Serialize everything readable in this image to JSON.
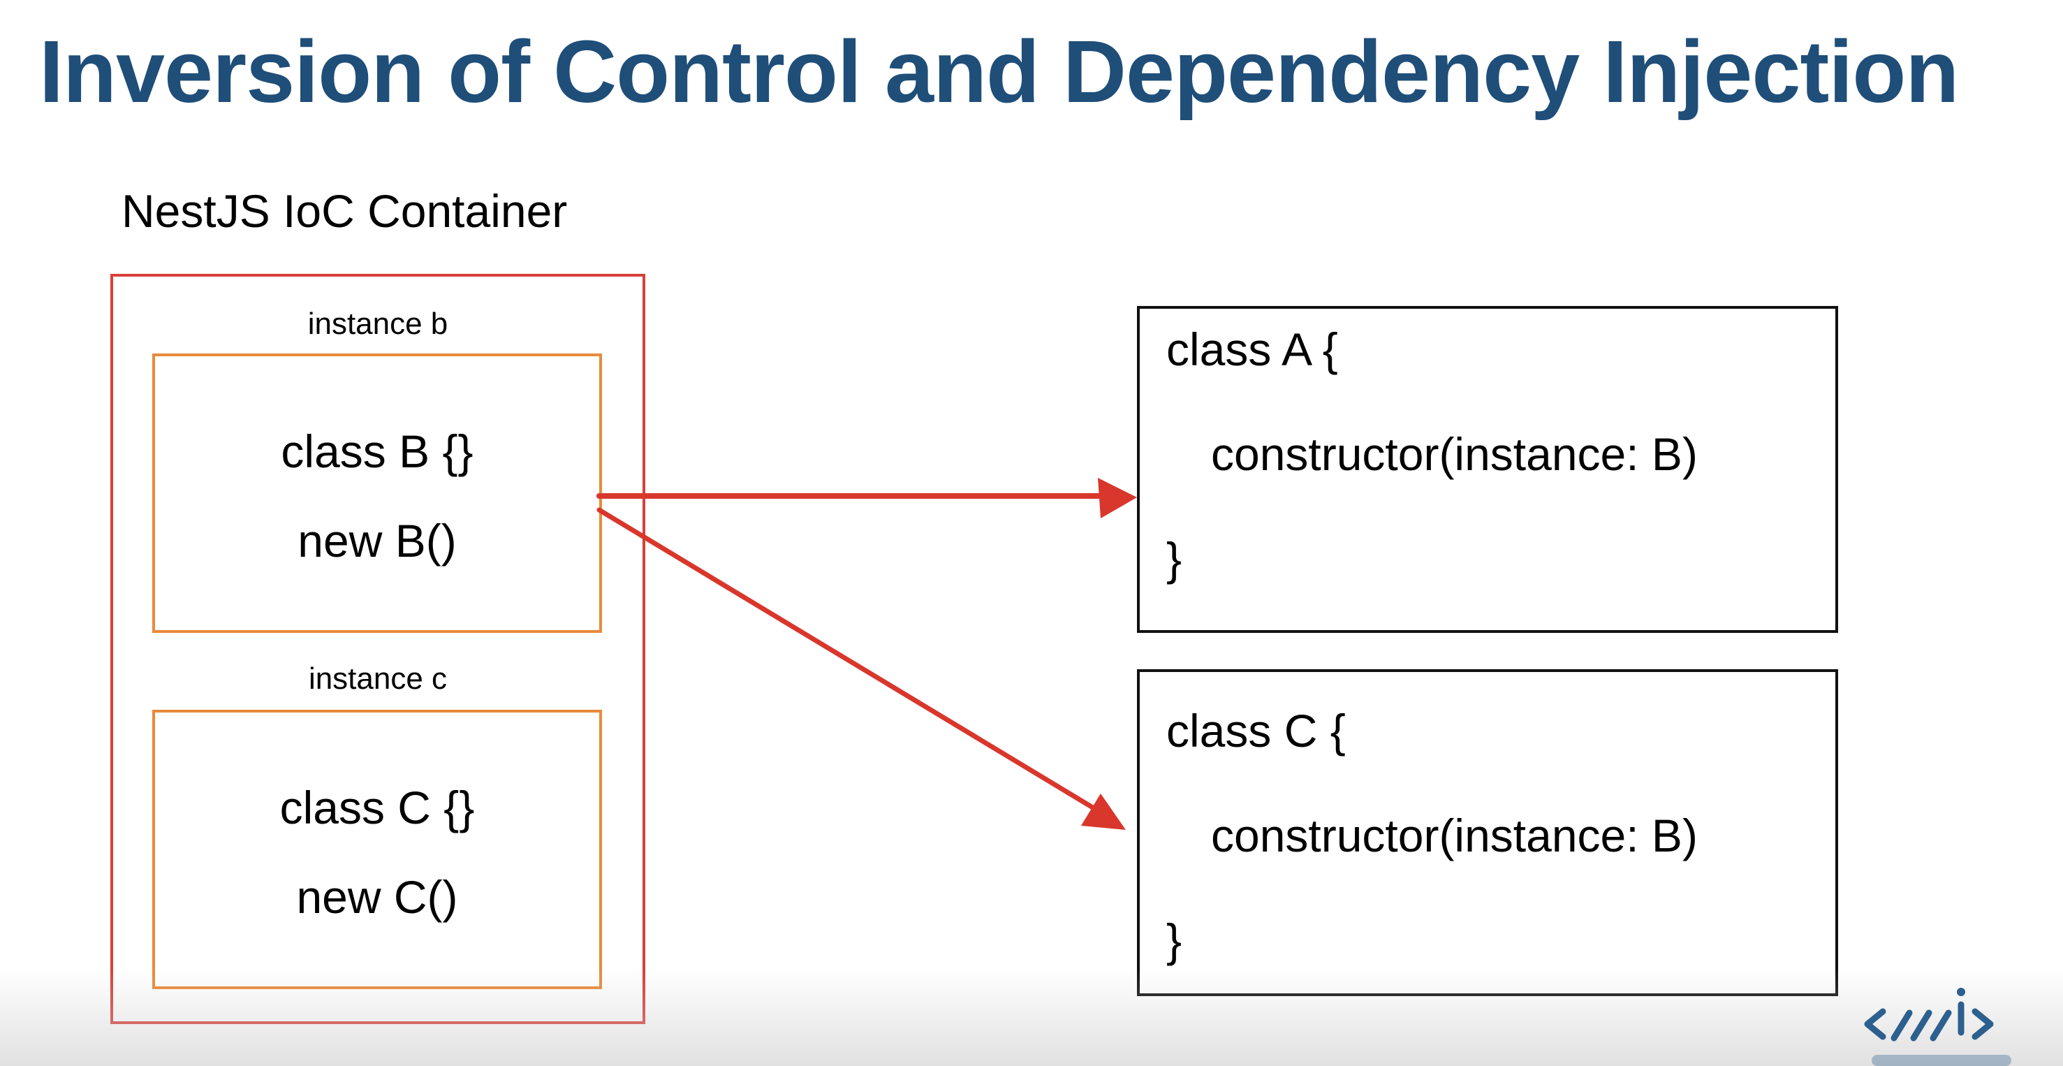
{
  "title": "Inversion of Control and Dependency Injection",
  "container": {
    "label": "NestJS IoC Container",
    "instances": [
      {
        "label": "instance b",
        "lines": [
          "class B {}",
          "new B()"
        ]
      },
      {
        "label": "instance c",
        "lines": [
          "class C {}",
          "new C()"
        ]
      }
    ]
  },
  "classes": [
    {
      "header": "class A {",
      "body": "constructor(instance: B)",
      "footer": "}"
    },
    {
      "header": "class C {",
      "body": "constructor(instance: B)",
      "footer": "}"
    }
  ],
  "colors": {
    "title": "#1f4e79",
    "container_border": "#d9403a",
    "instance_border": "#e98a3b",
    "arrow": "#d9362c",
    "class_border": "#111111",
    "logo": "#2d5f8f"
  },
  "logo": {
    "icon": "code-slash-logo-icon"
  }
}
